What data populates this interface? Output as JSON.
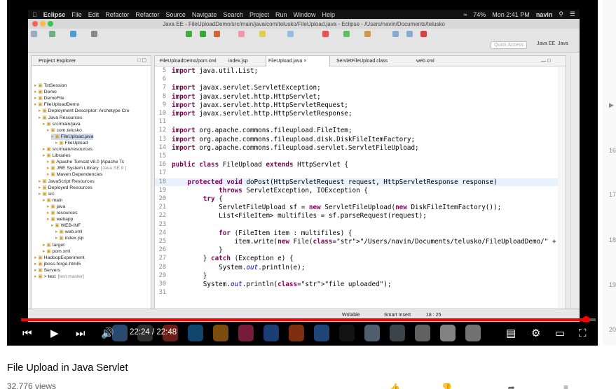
{
  "menubar": {
    "apple": "",
    "app": "Eclipse",
    "items": [
      "File",
      "Edit",
      "Refactor",
      "Refactor",
      "Source",
      "Navigate",
      "Search",
      "Project",
      "Run",
      "Window",
      "Help"
    ],
    "battery": "74%",
    "datetime": "Mon 2:41 PM",
    "user": "navin"
  },
  "window": {
    "title": "Java EE - FileUploadDemo/src/main/java/com/telusko/FileUpload.java - Eclipse - /Users/navin/Documents/telusko",
    "quick_access": "Quick Access",
    "perspective_javaee": "Java EE",
    "perspective_java": "Java"
  },
  "explorer": {
    "title": "Project Explorer",
    "items": [
      {
        "label": "TstSession",
        "extra": ""
      },
      {
        "label": "Demo",
        "extra": ""
      },
      {
        "label": "DemoFile",
        "extra": ""
      },
      {
        "label": "FileUploadDemo",
        "extra": ""
      },
      {
        "label": "Deployment Descriptor: Archetype Cre",
        "extra": ""
      },
      {
        "label": "Java Resources",
        "extra": ""
      },
      {
        "label": "src/main/java",
        "extra": ""
      },
      {
        "label": "com.telusko",
        "extra": ""
      },
      {
        "label": "FileUpload.java",
        "extra": ""
      },
      {
        "label": "FileUpload",
        "extra": ""
      },
      {
        "label": "src/main/resources",
        "extra": ""
      },
      {
        "label": "Libraries",
        "extra": ""
      },
      {
        "label": "Apache Tomcat v8.0 [Apache Tc",
        "extra": ""
      },
      {
        "label": "JRE System Library",
        "extra": "[Java SE 8 ["
      },
      {
        "label": "Maven Dependencies",
        "extra": ""
      },
      {
        "label": "JavaScript Resources",
        "extra": ""
      },
      {
        "label": "Deployed Resources",
        "extra": ""
      },
      {
        "label": "src",
        "extra": ""
      },
      {
        "label": "main",
        "extra": ""
      },
      {
        "label": "java",
        "extra": ""
      },
      {
        "label": "resources",
        "extra": ""
      },
      {
        "label": "webapp",
        "extra": ""
      },
      {
        "label": "WEB-INF",
        "extra": ""
      },
      {
        "label": "web.xml",
        "extra": ""
      },
      {
        "label": "index.jsp",
        "extra": ""
      },
      {
        "label": "target",
        "extra": ""
      },
      {
        "label": "pom.xml",
        "extra": ""
      },
      {
        "label": "HadoopExperiment",
        "extra": ""
      },
      {
        "label": "jboss-forge-html5",
        "extra": ""
      },
      {
        "label": "Servers",
        "extra": ""
      },
      {
        "label": "> test",
        "extra": "[test master]"
      }
    ]
  },
  "tabs": [
    "FileUploadDemo/pom.xml",
    "index.jsp",
    "FileUpload.java",
    "ServletFileUpload.class",
    "web.xml"
  ],
  "code": [
    {
      "n": "5",
      "t": "import java.util.List;"
    },
    {
      "n": "6",
      "t": ""
    },
    {
      "n": "7",
      "t": "import javax.servlet.ServletException;"
    },
    {
      "n": "8",
      "t": "import javax.servlet.http.HttpServlet;"
    },
    {
      "n": "9",
      "t": "import javax.servlet.http.HttpServletRequest;"
    },
    {
      "n": "10",
      "t": "import javax.servlet.http.HttpServletResponse;"
    },
    {
      "n": "11",
      "t": ""
    },
    {
      "n": "12",
      "t": "import org.apache.commons.fileupload.FileItem;"
    },
    {
      "n": "13",
      "t": "import org.apache.commons.fileupload.disk.DiskFileItemFactory;"
    },
    {
      "n": "14",
      "t": "import org.apache.commons.fileupload.servlet.ServletFileUpload;"
    },
    {
      "n": "15",
      "t": ""
    },
    {
      "n": "16",
      "t": "public class FileUpload extends HttpServlet {"
    },
    {
      "n": "17",
      "t": ""
    },
    {
      "n": "18",
      "t": "    protected void doPost(HttpServletRequest request, HttpServletResponse response)"
    },
    {
      "n": "19",
      "t": "            throws ServletException, IOException {"
    },
    {
      "n": "20",
      "t": "        try {"
    },
    {
      "n": "21",
      "t": "            ServletFileUpload sf = new ServletFileUpload(new DiskFileItemFactory());"
    },
    {
      "n": "22",
      "t": "            List<FileItem> multifiles = sf.parseRequest(request);"
    },
    {
      "n": "23",
      "t": ""
    },
    {
      "n": "24",
      "t": "            for (FileItem item : multifiles) {"
    },
    {
      "n": "25",
      "t": "                item.write(new File(\"/Users/navin/Documents/telusko/FileUploadDemo/\" + item.getName());"
    },
    {
      "n": "26",
      "t": "            }"
    },
    {
      "n": "27",
      "t": "        } catch (Exception e) {"
    },
    {
      "n": "28",
      "t": "            System.out.println(e);"
    },
    {
      "n": "29",
      "t": "        }"
    },
    {
      "n": "30",
      "t": "        System.out.println(\"file uploaded\");"
    },
    {
      "n": "31",
      "t": ""
    }
  ],
  "status": {
    "writable": "Writable",
    "insert": "Smart Insert",
    "position": "18 : 25"
  },
  "player": {
    "time": "22:24 / 22:48",
    "progress": 0.983
  },
  "video": {
    "title": "File Upload in Java Servlet",
    "views": "32,776 views"
  },
  "related_labels": [
    "16",
    "17",
    "18",
    "19",
    "20"
  ],
  "colors": {
    "accent": "#ff0000",
    "keyword": "#7f0055",
    "string": "#2a00ff"
  }
}
